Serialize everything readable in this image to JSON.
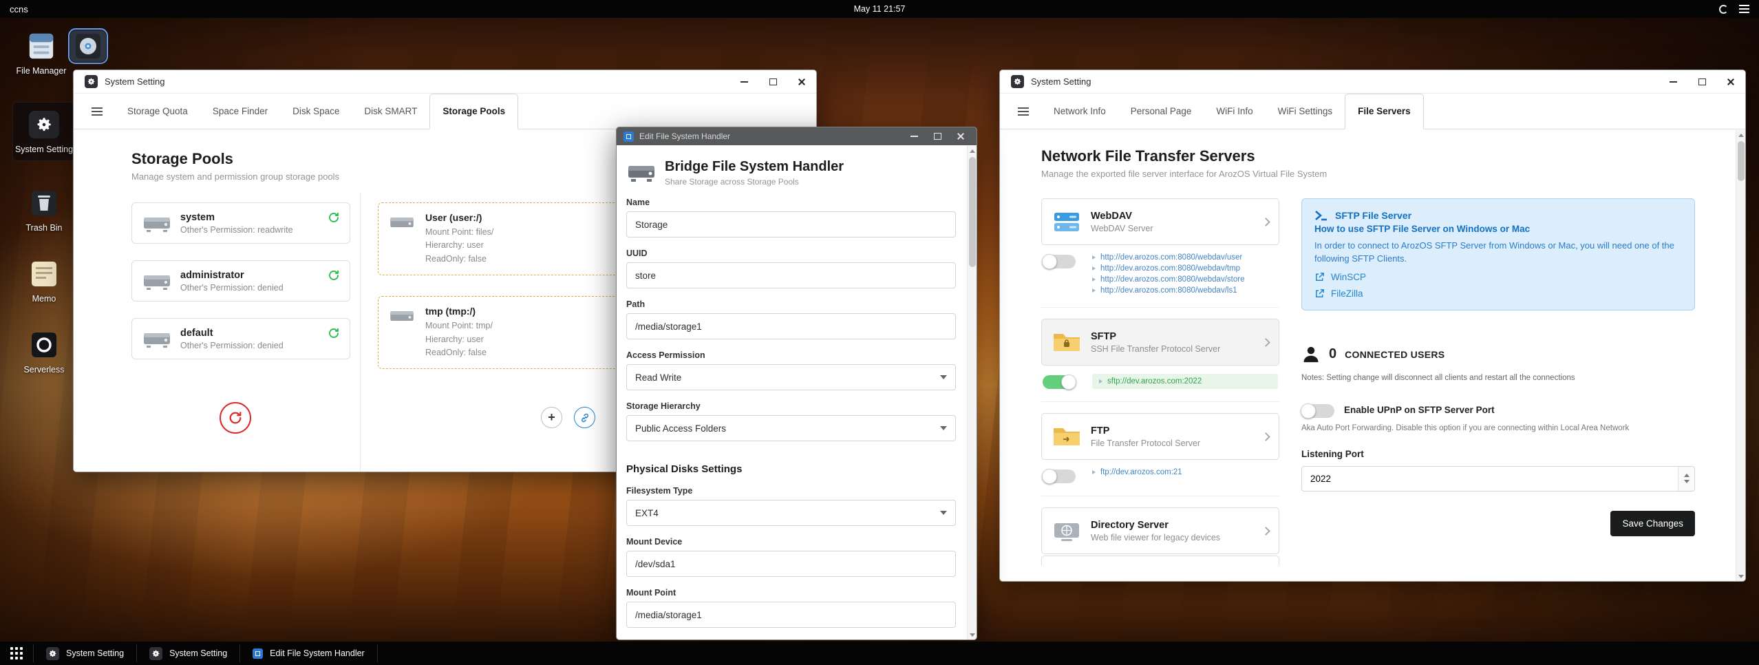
{
  "topbar": {
    "host": "ccns",
    "clock": "May 11 21:57"
  },
  "desktop_icons": {
    "file_manager": "File Manager",
    "system_setting": "System Setting",
    "trash_bin": "Trash Bin",
    "memo": "Memo",
    "serverless": "Serverless"
  },
  "storage_window": {
    "title": "System Setting",
    "tabs": [
      "Storage Quota",
      "Space Finder",
      "Disk Space",
      "Disk SMART",
      "Storage Pools"
    ],
    "heading": "Storage Pools",
    "subtitle": "Manage system and permission group storage pools",
    "pools": [
      {
        "name": "system",
        "permission": "Other's Permission: readwrite"
      },
      {
        "name": "administrator",
        "permission": "Other's Permission: denied"
      },
      {
        "name": "default",
        "permission": "Other's Permission: denied"
      }
    ],
    "mounts": [
      {
        "name": "User (user:/)",
        "mount_point": "Mount Point: files/",
        "hierarchy": "Hierarchy: user",
        "readonly": "ReadOnly: false"
      },
      {
        "name": "tmp (tmp:/)",
        "mount_point": "Mount Point: tmp/",
        "hierarchy": "Hierarchy: user",
        "readonly": "ReadOnly: false"
      }
    ]
  },
  "edit_window": {
    "title": "Edit File System Handler",
    "header_title": "Bridge File System Handler",
    "header_subtitle": "Share Storage across Storage Pools",
    "section_header": "Physical Disks Settings",
    "fields": {
      "name": {
        "label": "Name",
        "value": "Storage"
      },
      "uuid": {
        "label": "UUID",
        "value": "store"
      },
      "path": {
        "label": "Path",
        "value": "/media/storage1"
      },
      "access": {
        "label": "Access Permission",
        "value": "Read Write"
      },
      "hierarchy": {
        "label": "Storage Hierarchy",
        "value": "Public Access Folders"
      },
      "fstype": {
        "label": "Filesystem Type",
        "value": "EXT4"
      },
      "mount_device": {
        "label": "Mount Device",
        "value": "/dev/sda1"
      },
      "mount_point": {
        "label": "Mount Point",
        "value": "/media/storage1"
      }
    }
  },
  "servers_window": {
    "title": "System Setting",
    "tabs": [
      "Network Info",
      "Personal Page",
      "WiFi Info",
      "WiFi Settings",
      "File Servers"
    ],
    "heading": "Network File Transfer Servers",
    "subtitle": "Manage the exported file server interface for ArozOS Virtual File System",
    "services": [
      {
        "name": "WebDAV",
        "desc": "WebDAV Server",
        "links": [
          "http://dev.arozos.com:8080/webdav/user",
          "http://dev.arozos.com:8080/webdav/tmp",
          "http://dev.arozos.com:8080/webdav/store",
          "http://dev.arozos.com:8080/webdav/ls1"
        ]
      },
      {
        "name": "SFTP",
        "desc": "SSH File Transfer Protocol Server",
        "links": [
          "sftp://dev.arozos.com:2022"
        ]
      },
      {
        "name": "FTP",
        "desc": "File Transfer Protocol Server",
        "links": [
          "ftp://dev.arozos.com:21"
        ]
      },
      {
        "name": "Directory Server",
        "desc": "Web file viewer for legacy devices",
        "links": []
      }
    ],
    "sftp_help": {
      "title": "SFTP File Server",
      "subtitle": "How to use SFTP File Server on Windows or Mac",
      "body": "In order to connect to ArozOS SFTP Server from Windows or Mac, you will need one of the following SFTP Clients.",
      "clients": [
        "WinSCP",
        "FileZilla"
      ]
    },
    "connected_users": {
      "count": "0",
      "label": "CONNECTED USERS",
      "notes": "Notes: Setting change will disconnect all clients and restart all the connections"
    },
    "upnp": {
      "label": "Enable UPnP on SFTP Server Port",
      "desc": "Aka Auto Port Forwarding. Disable this option if you are connecting within Local Area Network"
    },
    "listening_port_label": "Listening Port",
    "listening_port_value": "2022",
    "save_label": "Save Changes"
  },
  "taskbar": {
    "items": [
      {
        "label": "System Setting"
      },
      {
        "label": "System Setting"
      },
      {
        "label": "Edit File System Handler"
      }
    ]
  }
}
